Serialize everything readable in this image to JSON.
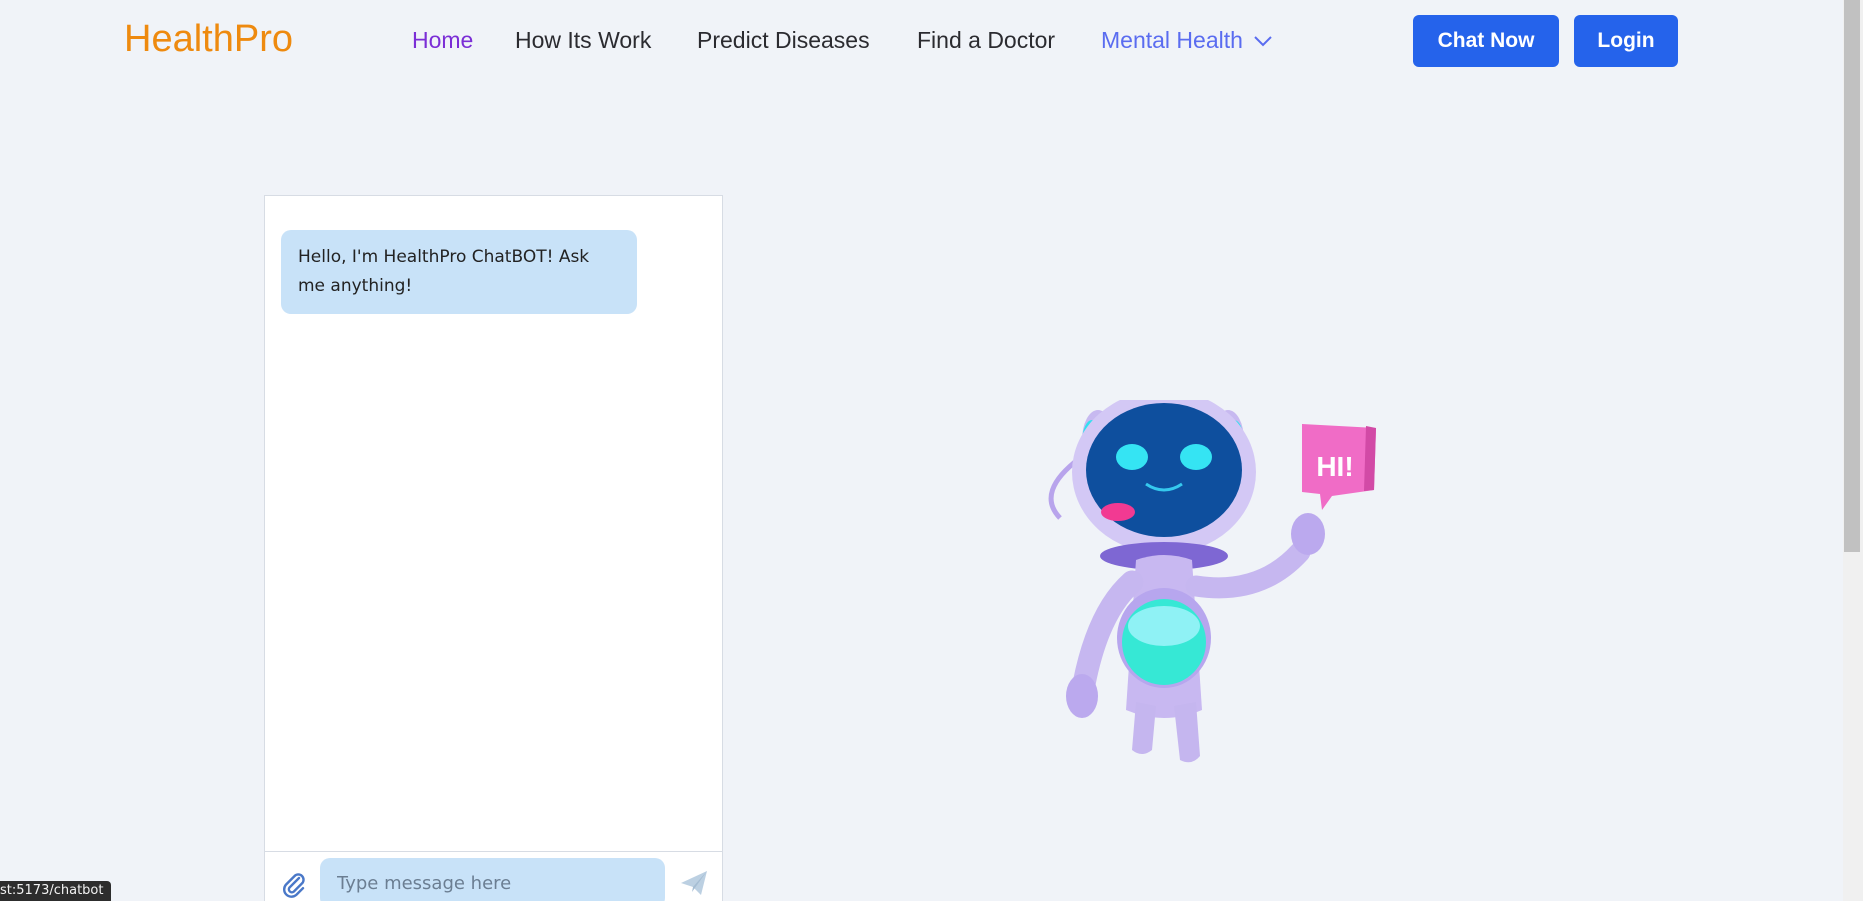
{
  "brand": {
    "logo": "HealthPro"
  },
  "nav": {
    "items": [
      {
        "label": "Home",
        "active": true
      },
      {
        "label": "How Its Work"
      },
      {
        "label": "Predict Diseases"
      },
      {
        "label": "Find a Doctor"
      },
      {
        "label": "Mental Health",
        "has_dropdown": true
      }
    ],
    "chat_now_label": "Chat Now",
    "login_label": "Login"
  },
  "chat": {
    "messages": [
      {
        "sender": "bot",
        "text": "Hello, I'm HealthPro ChatBOT! Ask me anything!"
      }
    ],
    "input_value": "",
    "input_placeholder": "Type message here"
  },
  "illustration": {
    "icon": "robot-waving-illustration",
    "speech_bubble_text": "HI!"
  },
  "status_bar": {
    "url": "st:5173/chatbot"
  },
  "colors": {
    "background": "#f0f3f8",
    "logo": "#ee8a0f",
    "active_nav": "#7b2ed6",
    "mental_health_nav": "#5a6cf0",
    "button": "#2563eb",
    "chat_bubble": "#c8e2f8"
  }
}
